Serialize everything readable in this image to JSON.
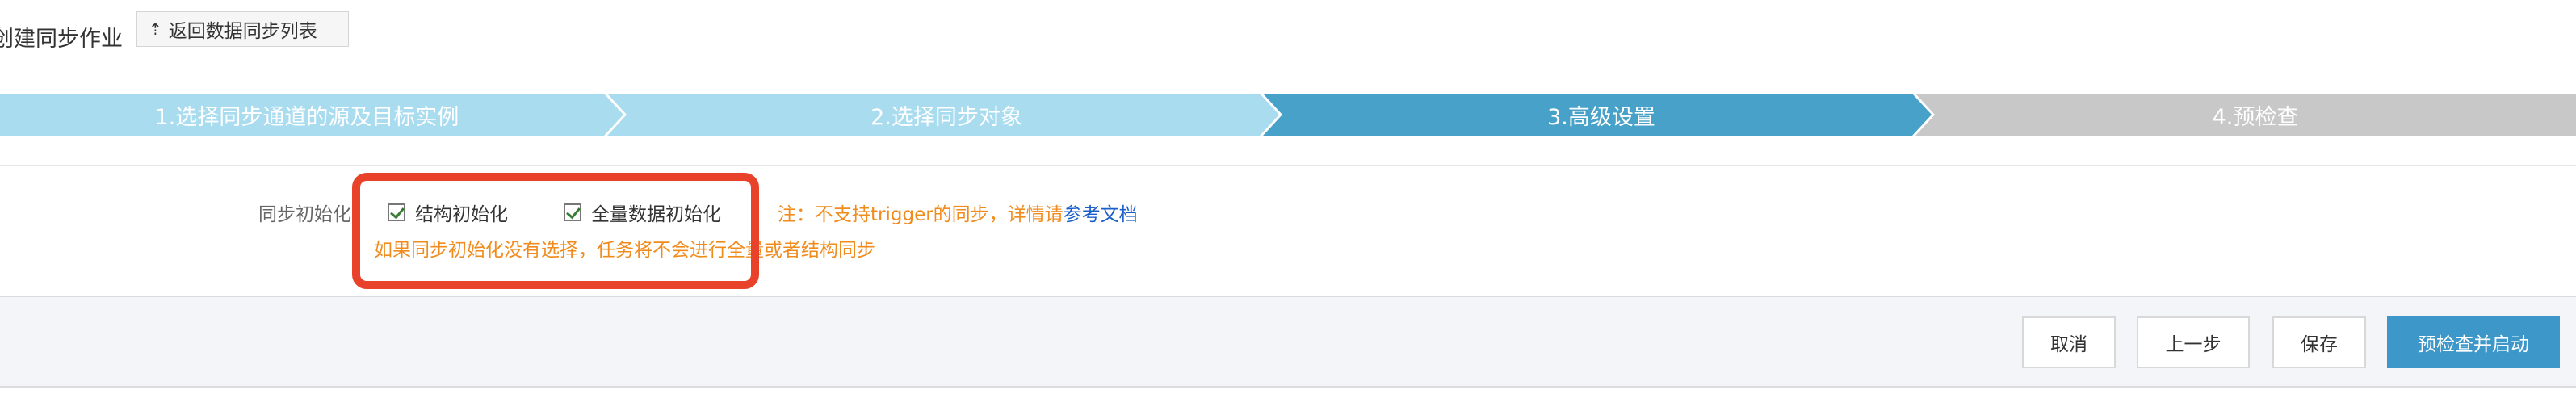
{
  "header": {
    "title": "创建同步作业",
    "back_label": "返回数据同步列表"
  },
  "steps": [
    {
      "label": "1.选择同步通道的源及目标实例"
    },
    {
      "label": "2.选择同步对象"
    },
    {
      "label": "3.高级设置"
    },
    {
      "label": "4.预检查"
    }
  ],
  "colors": {
    "step_done": "#a9dcef",
    "step_active": "#47a1c8",
    "step_pending": "#c8c8c8",
    "note": "#f08c1e",
    "link": "#1a5ec8",
    "highlight": "#e8432a",
    "primary": "#3d97c9"
  },
  "form": {
    "label": "同步初始化",
    "options": [
      {
        "label": "结构初始化",
        "checked": true
      },
      {
        "label": "全量数据初始化",
        "checked": true
      }
    ],
    "note_prefix": "注：不支持trigger的同步，详情请",
    "note_link": "参考文档",
    "warning": "如果同步初始化没有选择，任务将不会进行全量或者结构同步"
  },
  "footer": {
    "cancel": "取消",
    "prev": "上一步",
    "save": "保存",
    "precheck_start": "预检查并启动"
  }
}
